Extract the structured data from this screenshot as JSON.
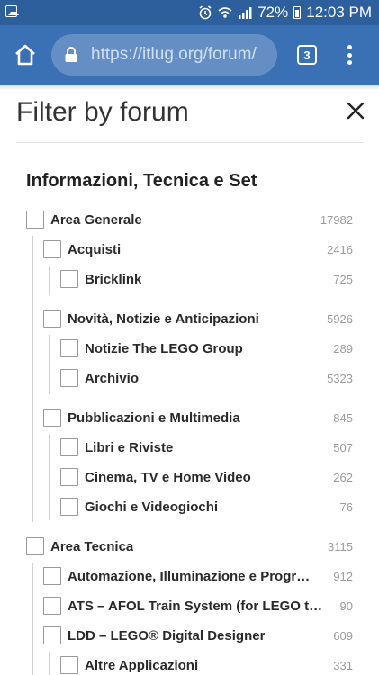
{
  "status_bar": {
    "battery": "72%",
    "time": "12:03 PM",
    "icons": [
      "gallery-icon",
      "alarm-icon",
      "wifi-icon",
      "signal-icon",
      "battery-icon"
    ]
  },
  "browser": {
    "url_host": "https://itlug.org",
    "url_path": "/forum/",
    "tab_count": "3",
    "icons": [
      "home-icon",
      "lock-icon",
      "tabs-icon",
      "overflow-menu-icon"
    ]
  },
  "panel": {
    "title": "Filter by forum",
    "close_icon": "close-icon"
  },
  "section": {
    "title": "Informazioni, Tecnica e Set",
    "forums": [
      {
        "label": "Area Generale",
        "count": "17982"
      },
      {
        "label": "Acquisti",
        "count": "2416"
      },
      {
        "label": "Bricklink",
        "count": "725"
      },
      {
        "label": "Novità, Notizie e Anticipazioni",
        "count": "5926"
      },
      {
        "label": "Notizie The LEGO Group",
        "count": "289"
      },
      {
        "label": "Archivio",
        "count": "5323"
      },
      {
        "label": "Pubblicazioni e Multimedia",
        "count": "845"
      },
      {
        "label": "Libri e Riviste",
        "count": "507"
      },
      {
        "label": "Cinema, TV e Home Video",
        "count": "262"
      },
      {
        "label": "Giochi e Videogiochi",
        "count": "76"
      },
      {
        "label": "Area Tecnica",
        "count": "3115"
      },
      {
        "label": "Automazione, Illuminazione e Programmazione",
        "count": "912"
      },
      {
        "label": "ATS – AFOL Train System (for LEGO trains)",
        "count": "90"
      },
      {
        "label": "LDD – LEGO® Digital Designer",
        "count": "609"
      },
      {
        "label": "Altre Applicazioni",
        "count": "331"
      }
    ]
  }
}
